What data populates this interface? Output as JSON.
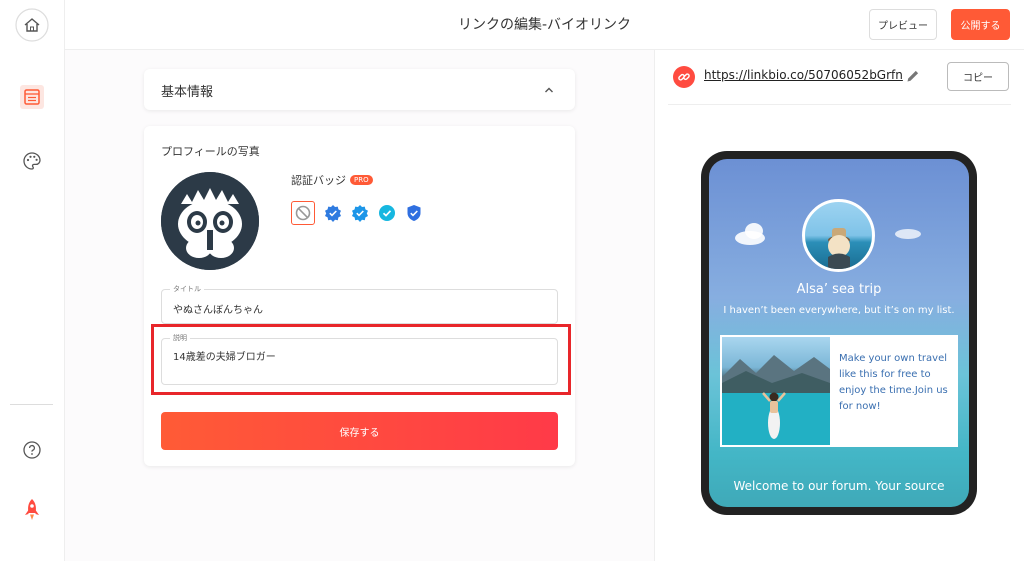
{
  "header": {
    "title": "リンクの編集-バイオリンク",
    "preview_label": "プレビュー",
    "publish_label": "公開する"
  },
  "sidebar": {
    "items": [
      {
        "icon": "home-icon"
      },
      {
        "icon": "page-icon"
      },
      {
        "icon": "palette-icon"
      },
      {
        "icon": "help-icon"
      },
      {
        "icon": "rocket-icon"
      }
    ]
  },
  "editor": {
    "basic_section_title": "基本情報",
    "profile": {
      "photo_label": "プロフィールの写真",
      "badge_label": "認証バッジ",
      "pro_label": "PRO",
      "title_label": "タイトル",
      "title_value": "やぬさんぼんちゃん",
      "description_label": "説明",
      "description_value": "14歳差の夫婦ブロガー"
    },
    "save_label": "保存する"
  },
  "preview": {
    "link_url": "https://linkbio.co/50706052bGrfn",
    "copy_label": "コピー",
    "profile_name": "Alsa’ sea trip",
    "bio": "I haven’t been everywhere, but it’s on my list.",
    "card_text": "Make your own travel like this for free to enjoy the time.Join us for now!",
    "footer_text": "Welcome to our forum. Your source"
  },
  "colors": {
    "accent": "#ff5a36",
    "highlight": "#e8262a",
    "badge_blue": "#2f7be0",
    "badge_teal": "#16b7e0"
  }
}
